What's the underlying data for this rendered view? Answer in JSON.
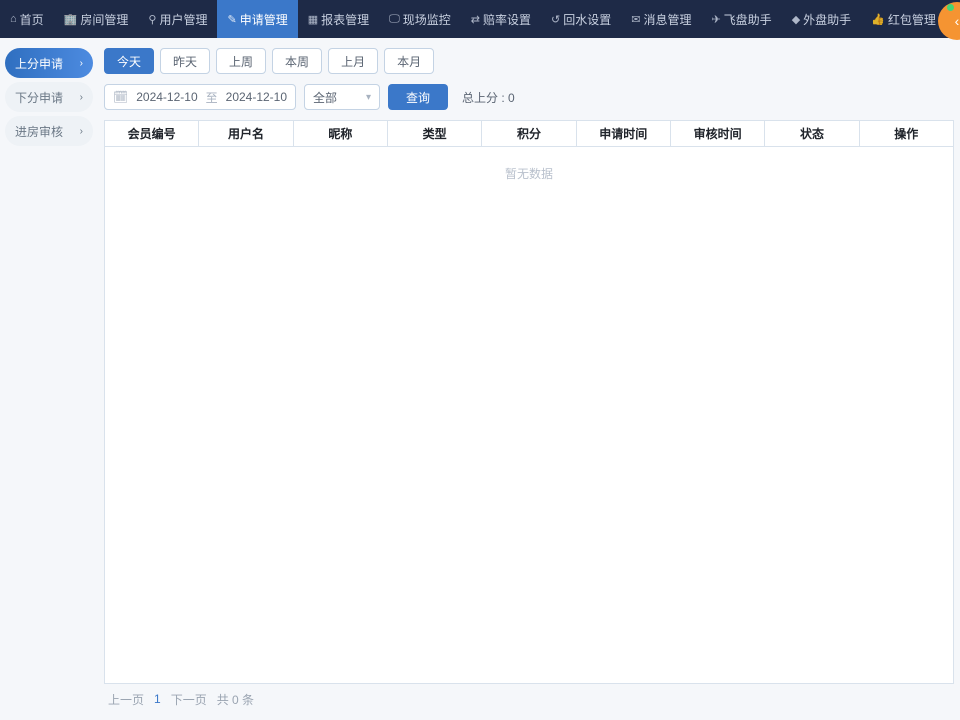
{
  "topnav": {
    "items": [
      {
        "icon": "⌂",
        "label": "首页"
      },
      {
        "icon": "🏢",
        "label": "房间管理"
      },
      {
        "icon": "⚲",
        "label": "用户管理"
      },
      {
        "icon": "✎",
        "label": "申请管理",
        "active": true
      },
      {
        "icon": "▦",
        "label": "报表管理"
      },
      {
        "icon": "🖵",
        "label": "现场监控"
      },
      {
        "icon": "⇄",
        "label": "赔率设置"
      },
      {
        "icon": "↺",
        "label": "回水设置"
      },
      {
        "icon": "✉",
        "label": "消息管理"
      },
      {
        "icon": "✈",
        "label": "飞盘助手"
      },
      {
        "icon": "◆",
        "label": "外盘助手"
      },
      {
        "icon": "👍",
        "label": "红包管理"
      }
    ],
    "avatar_chevron": "‹"
  },
  "sidebar": {
    "items": [
      {
        "label": "上分申请",
        "active": true
      },
      {
        "label": "下分申请"
      },
      {
        "label": "进房审核"
      }
    ],
    "chevron": "›"
  },
  "filters": {
    "quick_ranges": [
      {
        "label": "今天",
        "active": true
      },
      {
        "label": "昨天"
      },
      {
        "label": "上周"
      },
      {
        "label": "本周"
      },
      {
        "label": "上月"
      },
      {
        "label": "本月"
      }
    ],
    "date_start": "2024-12-10",
    "date_sep": "至",
    "date_end": "2024-12-10",
    "status": "全部",
    "search_label": "查询",
    "total_label": "总上分 : 0"
  },
  "table": {
    "headers": [
      "会员编号",
      "用户名",
      "昵称",
      "类型",
      "积分",
      "申请时间",
      "审核时间",
      "状态",
      "操作"
    ],
    "empty_text": "暂无数据"
  },
  "pager": {
    "prev": "上一页",
    "current": "1",
    "next": "下一页",
    "total": "共 0 条"
  }
}
